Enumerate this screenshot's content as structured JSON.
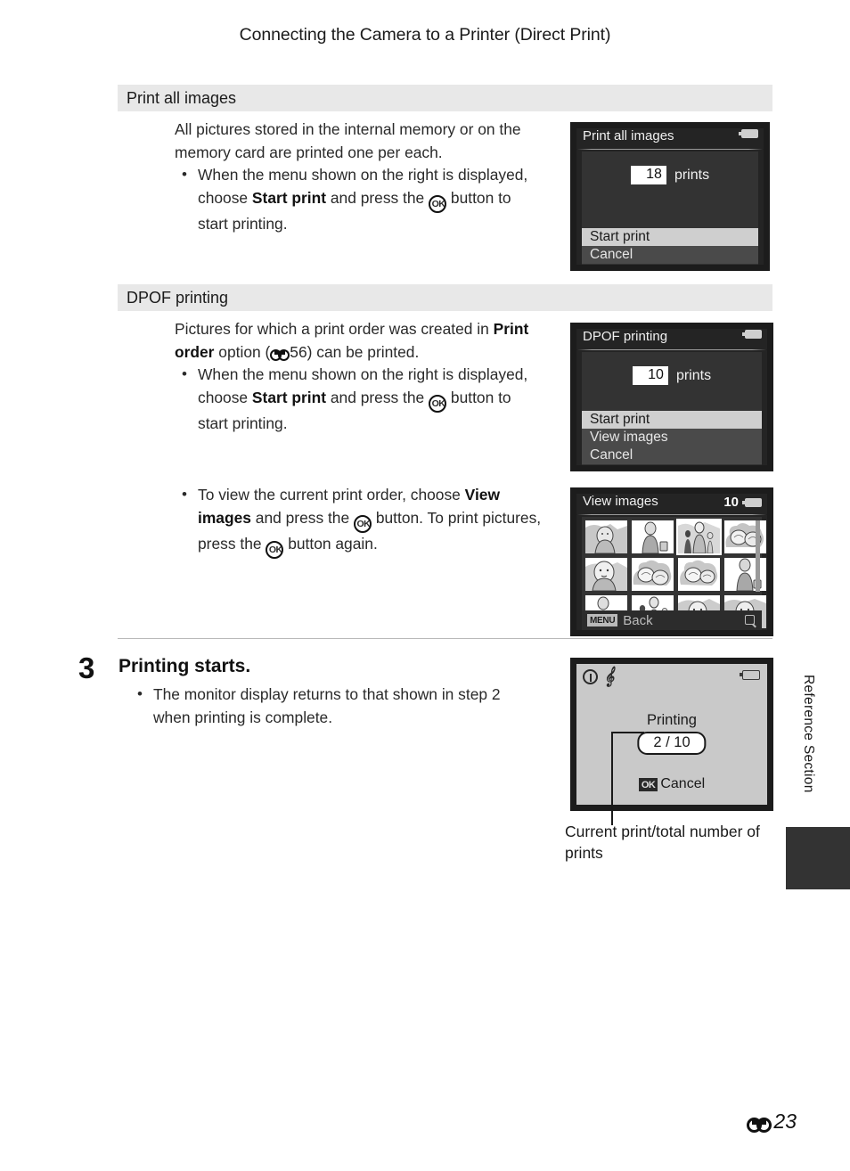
{
  "header": {
    "running_head": "Connecting the Camera to a Printer (Direct Print)"
  },
  "sections": [
    {
      "band_title": "Print all images",
      "intro": "All pictures stored in the internal memory or on the memory card are printed one per each.",
      "bullet_pre": "When the menu shown on the right is displayed, choose ",
      "bullet_bold": "Start print",
      "bullet_mid": " and press the ",
      "bullet_post": " button to start printing.",
      "screen": {
        "title": "Print all images",
        "count": "18",
        "count_label": "prints",
        "options": [
          {
            "label": "Start print",
            "selected": true
          },
          {
            "label": "Cancel",
            "selected": false
          }
        ]
      }
    },
    {
      "band_title": "DPOF printing",
      "intro_pre": "Pictures for which a print order was created in ",
      "intro_bold": "Print order",
      "intro_mid": " option (",
      "intro_ref": "56",
      "intro_post": ") can be printed.",
      "bullet_pre": "When the menu shown on the right is displayed, choose ",
      "bullet_bold": "Start print",
      "bullet_mid": " and press the ",
      "bullet_post": " button to start printing.",
      "screen": {
        "title": "DPOF printing",
        "count": "10",
        "count_label": "prints",
        "options": [
          {
            "label": "Start print",
            "selected": true
          },
          {
            "label": "View images",
            "selected": false
          },
          {
            "label": "Cancel",
            "selected": false
          }
        ]
      }
    }
  ],
  "view_images": {
    "bullet_pre": "To view the current print order, choose ",
    "bullet_bold": "View images",
    "bullet_mid": " and press the ",
    "bullet_mid2": " button. To print pictures, press the ",
    "bullet_post": " button again.",
    "screen": {
      "title": "View images",
      "count": "10",
      "footer_badge": "MENU",
      "footer_label": "Back",
      "selected_index": 2,
      "thumbs": [
        "portrait-beach",
        "person-child",
        "mother-children",
        "flowers",
        "portrait-closeup",
        "flowers",
        "flowers",
        "person-child",
        "person-child",
        "mother-children",
        "portrait-beach",
        "portrait-beach"
      ]
    }
  },
  "step": {
    "number": "3",
    "title": "Printing starts.",
    "bullet": "The monitor display returns to that shown in step 2 when printing is complete.",
    "screen": {
      "printing_label": "Printing",
      "counter": "2 / 10",
      "cancel_badge": "OK",
      "cancel_label": "Cancel",
      "warning_icon": "exclamation-circle-icon",
      "shake_icon": "camera-shake-icon"
    },
    "caption": "Current print/total number of prints"
  },
  "side": {
    "label": "Reference Section"
  },
  "footer": {
    "page_number": "23",
    "section_glyph": "chain-link-icon"
  },
  "colors": {
    "band_bg": "#e8e8e8",
    "lcd_bg": "#1c1c1c",
    "lcd_body": "#333333",
    "selected_row": "#cfcfcf",
    "unselected_row": "#4a4a4a",
    "light_screen": "#c9c9c9",
    "side_tab": "#333333"
  }
}
